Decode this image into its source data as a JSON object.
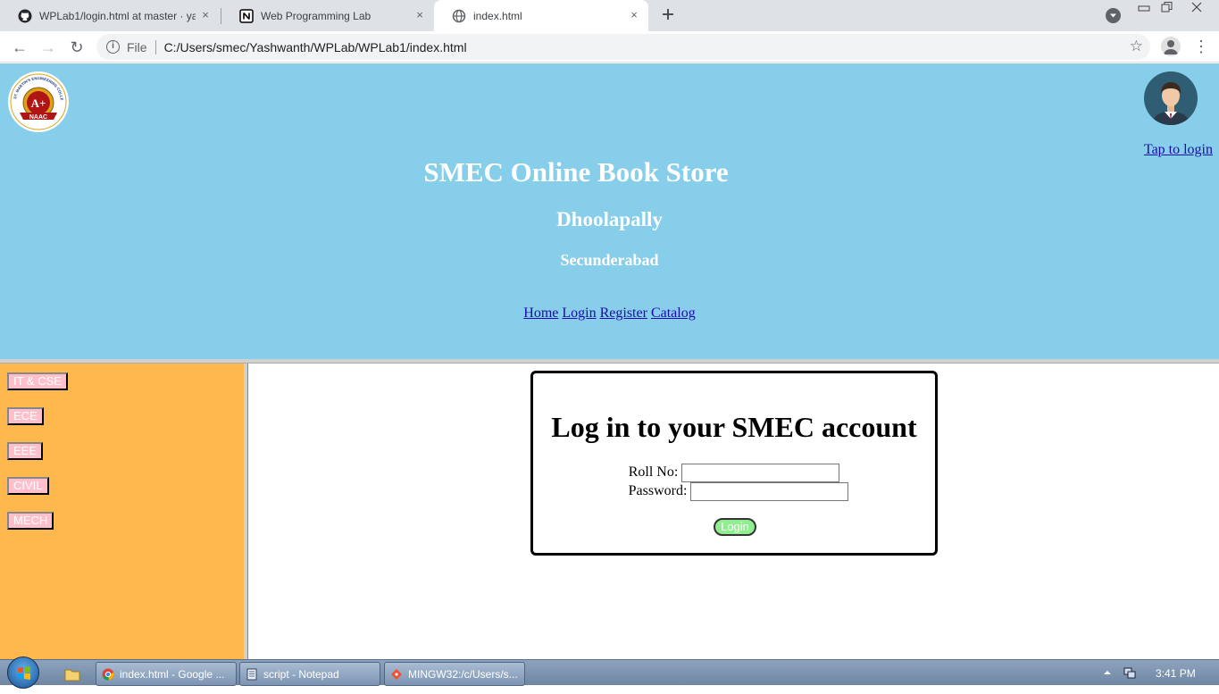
{
  "browser": {
    "tabs": [
      {
        "title": "WPLab1/login.html at master · ya",
        "active": false
      },
      {
        "title": "Web Programming Lab",
        "active": false
      },
      {
        "title": "index.html",
        "active": true
      }
    ],
    "new_tab_icon": "plus-icon",
    "close_icon": "×",
    "url_scheme": "File",
    "url": "C:/Users/smec/Yashwanth/WPLab/WPLab1/index.html",
    "back_icon": "←",
    "forward_icon": "→",
    "reload_icon": "↻",
    "star_icon": "☆",
    "menu_icon": "⋮",
    "info_icon": "i"
  },
  "page": {
    "title": "SMEC Online Book Store",
    "subtitle": "Dhoolapally",
    "subsubtitle": "Secunderabad",
    "tap_to_login": "Tap to login",
    "nav": [
      "Home",
      "Login",
      "Register",
      "Catalog"
    ],
    "logo_text": {
      "top": "ST. MARTIN'S ENGINEERING COLLEGE",
      "grade": "A+",
      "naac": "NAAC"
    },
    "departments": [
      "IT & CSE",
      "ECE",
      "EEE",
      "CIVIL",
      "MECH"
    ],
    "login_box": {
      "heading": "Log in to your SMEC account",
      "roll_label": "Roll No:",
      "password_label": "Password:",
      "roll_value": "",
      "password_value": "",
      "button": "Login"
    },
    "colors": {
      "header": "#87ceea",
      "sidebar": "#ffb84d",
      "dept_button": "#ffc0cb",
      "login_button": "#90ee90"
    }
  },
  "taskbar": {
    "tasks": [
      {
        "label": "index.html - Google ..."
      },
      {
        "label": "script - Notepad"
      },
      {
        "label": "MINGW32:/c/Users/s..."
      }
    ],
    "time": "3:41 PM"
  }
}
